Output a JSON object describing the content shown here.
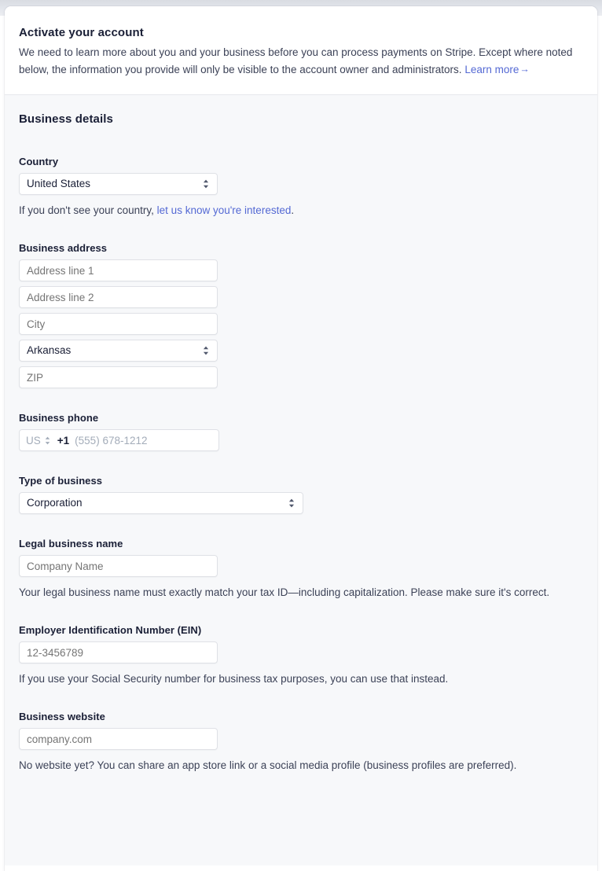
{
  "header": {
    "title": "Activate your account",
    "description_part1": "We need to learn more about you and your business before you can process payments on Stripe. Except where noted below, the information you provide will only be visible to the account owner and administrators. ",
    "learn_more_label": "Learn more",
    "arrow": "→"
  },
  "section": {
    "title": "Business details"
  },
  "country": {
    "label": "Country",
    "value": "United States",
    "help_prefix": "If you don't see your country, ",
    "help_link": "let us know you're interested",
    "help_suffix": "."
  },
  "address": {
    "label": "Business address",
    "line1_placeholder": "Address line 1",
    "line1_value": "",
    "line2_placeholder": "Address line 2",
    "line2_value": "",
    "city_placeholder": "City",
    "city_value": "",
    "state_value": "Arkansas",
    "zip_placeholder": "ZIP",
    "zip_value": ""
  },
  "phone": {
    "label": "Business phone",
    "country_code": "US",
    "dial_code": "+1",
    "placeholder": "(555) 678-1212",
    "value": ""
  },
  "business_type": {
    "label": "Type of business",
    "value": "Corporation"
  },
  "legal_name": {
    "label": "Legal business name",
    "placeholder": "Company Name",
    "value": "",
    "help": "Your legal business name must exactly match your tax ID—including capitalization. Please make sure it's correct."
  },
  "ein": {
    "label": "Employer Identification Number (EIN)",
    "placeholder": "12-3456789",
    "value": "",
    "help": "If you use your Social Security number for business tax purposes, you can use that instead."
  },
  "website": {
    "label": "Business website",
    "placeholder": "company.com",
    "value": "",
    "help": "No website yet? You can share an app store link or a social media profile (business profiles are preferred)."
  },
  "colors": {
    "accent": "#5469d4",
    "heading": "#1a1f36",
    "body_text": "#3c4257",
    "placeholder": "#a3acb9",
    "border": "#dfe1e6",
    "panel_bg": "#f7f8fa"
  }
}
